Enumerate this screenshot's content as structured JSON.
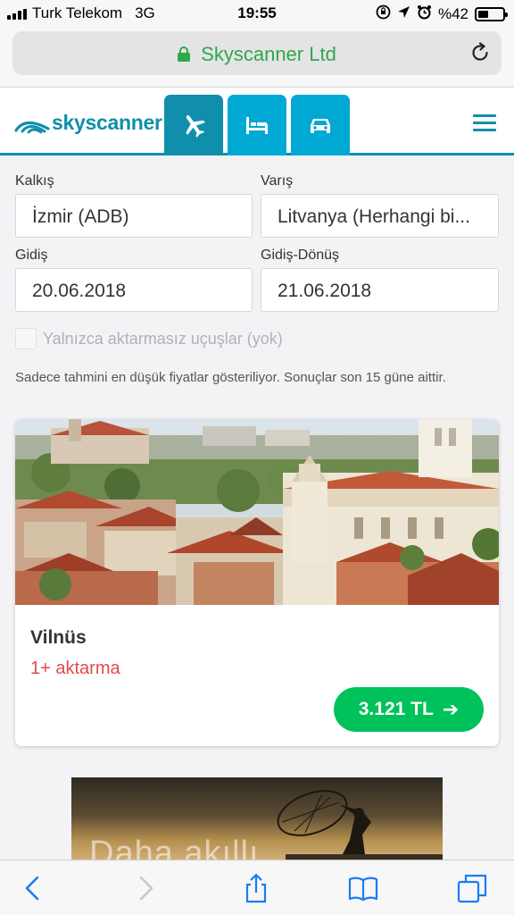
{
  "status_bar": {
    "carrier": "Turk Telekom",
    "network": "3G",
    "time": "19:55",
    "battery": "%42",
    "battery_level": 0.42
  },
  "browser": {
    "site_label": "Skyscanner Ltd",
    "secure_color": "#2fa84a"
  },
  "header": {
    "logo_text": "skyscanner",
    "brand_color": "#0f8fab",
    "tabs": [
      {
        "name": "flights",
        "icon": "airplane-icon",
        "active": true
      },
      {
        "name": "hotels",
        "icon": "bed-icon",
        "active": false
      },
      {
        "name": "cars",
        "icon": "car-icon",
        "active": false
      }
    ],
    "menu_icon": "hamburger-menu-icon"
  },
  "search": {
    "from_label": "Kalkış",
    "from_value": "İzmir (ADB)",
    "to_label": "Varış",
    "to_value": "Litvanya (Herhangi bi...",
    "depart_label": "Gidiş",
    "depart_value": "20.06.2018",
    "return_label": "Gidiş-Dönüş",
    "return_value": "21.06.2018",
    "direct_only_label": "Yalnızca aktarmasız uçuşlar (yok)",
    "direct_only_checked": false
  },
  "notice": "Sadece tahmini en düşük fiyatlar gösteriliyor. Sonuçlar son 15 güne aittir.",
  "result": {
    "city": "Vilnüs",
    "stops": "1+ aktarma",
    "price": "3.121 TL",
    "price_color": "#00c25a",
    "stops_color": "#e24b4b"
  },
  "ad": {
    "text": "Daha akıllı"
  }
}
